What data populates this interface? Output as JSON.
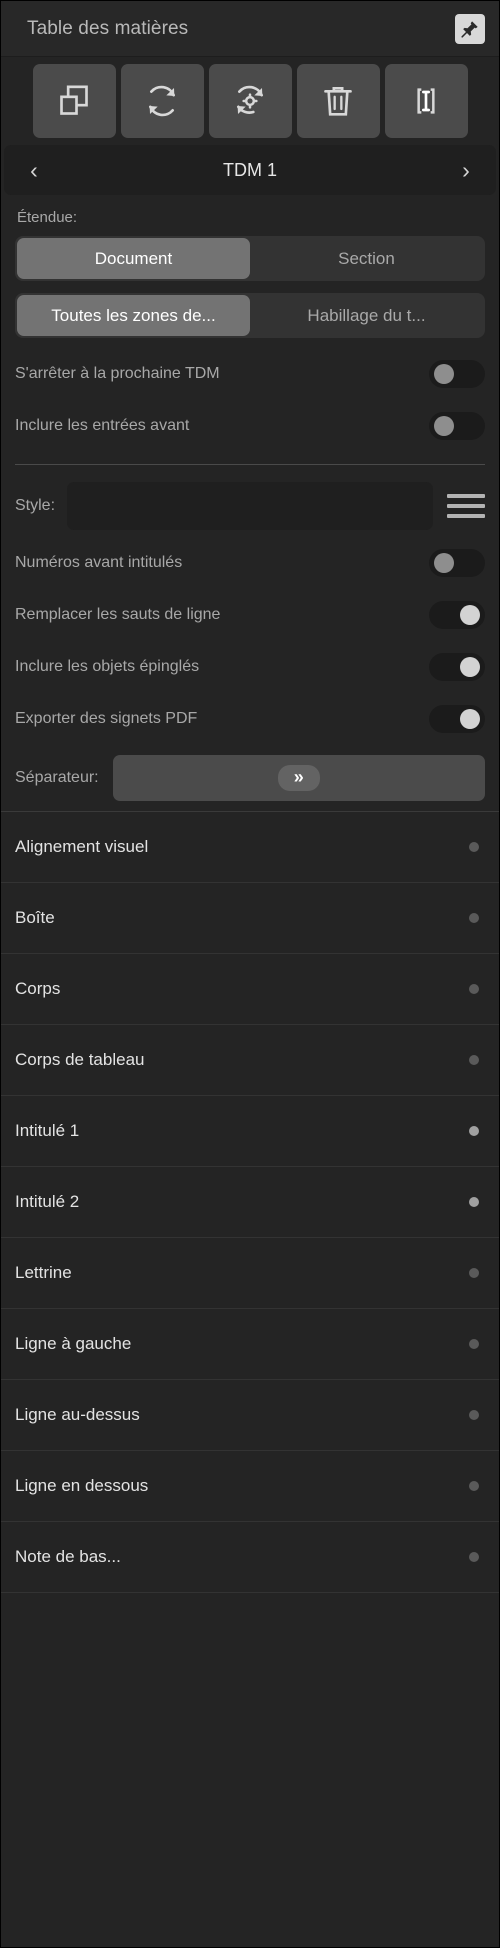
{
  "panel": {
    "title": "Table des matières",
    "pin_icon": "pin-icon"
  },
  "toolbar": {
    "buttons": [
      {
        "name": "duplicate-toc-button",
        "icon": "copy-icon"
      },
      {
        "name": "update-toc-button",
        "icon": "refresh-icon"
      },
      {
        "name": "update-toc-settings-button",
        "icon": "refresh-gear-icon"
      },
      {
        "name": "delete-toc-button",
        "icon": "trash-icon"
      },
      {
        "name": "insert-toc-text-button",
        "icon": "text-cursor-icon"
      }
    ]
  },
  "nav": {
    "prev_label": "‹",
    "title": "TDM 1",
    "next_label": "›"
  },
  "scope": {
    "label": "Étendue:",
    "segment_one": {
      "options": [
        "Document",
        "Section"
      ],
      "selected": "Document"
    },
    "segment_two": {
      "options": [
        "Toutes les zones de...",
        "Habillage du t..."
      ],
      "selected": "Toutes les zones de..."
    }
  },
  "options": {
    "stop_at_next_toc": {
      "label": "S'arrêter à la prochaine TDM",
      "state": "off"
    },
    "include_entries_before": {
      "label": "Inclure les entrées avant",
      "state": "off"
    }
  },
  "style": {
    "label": "Style:",
    "value": "",
    "menu_icon": "hamburger-icon"
  },
  "format_options": {
    "numbers_before_titles": {
      "label": "Numéros avant intitulés",
      "state": "off"
    },
    "replace_line_breaks": {
      "label": "Remplacer les sauts de ligne",
      "state": "on"
    },
    "include_pinned_objects": {
      "label": "Inclure les objets épinglés",
      "state": "on"
    },
    "export_pdf_bookmarks": {
      "label": "Exporter des signets PDF",
      "state": "on"
    }
  },
  "separator": {
    "label": "Séparateur:",
    "value": "»"
  },
  "style_list": [
    {
      "name": "Alignement visuel",
      "included": false
    },
    {
      "name": "Boîte",
      "included": false
    },
    {
      "name": "Corps",
      "included": false
    },
    {
      "name": "Corps de tableau",
      "included": false
    },
    {
      "name": "Intitulé 1",
      "included": true
    },
    {
      "name": "Intitulé 2",
      "included": true
    },
    {
      "name": "Lettrine",
      "included": false
    },
    {
      "name": "Ligne à gauche",
      "included": false
    },
    {
      "name": "Ligne au-dessus",
      "included": false
    },
    {
      "name": "Ligne en dessous",
      "included": false
    },
    {
      "name": "Note de bas...",
      "included": false
    }
  ],
  "colors": {
    "panel_bg": "#242424",
    "titlebar_bg": "#282828",
    "button_bg": "#4b4b4b",
    "accent_selected": "#737373",
    "text_primary": "#e3e3e3",
    "text_secondary": "#a8a8a8",
    "toggle_on_knob": "#d3d3d3",
    "toggle_off_knob": "#8e8e8e"
  }
}
